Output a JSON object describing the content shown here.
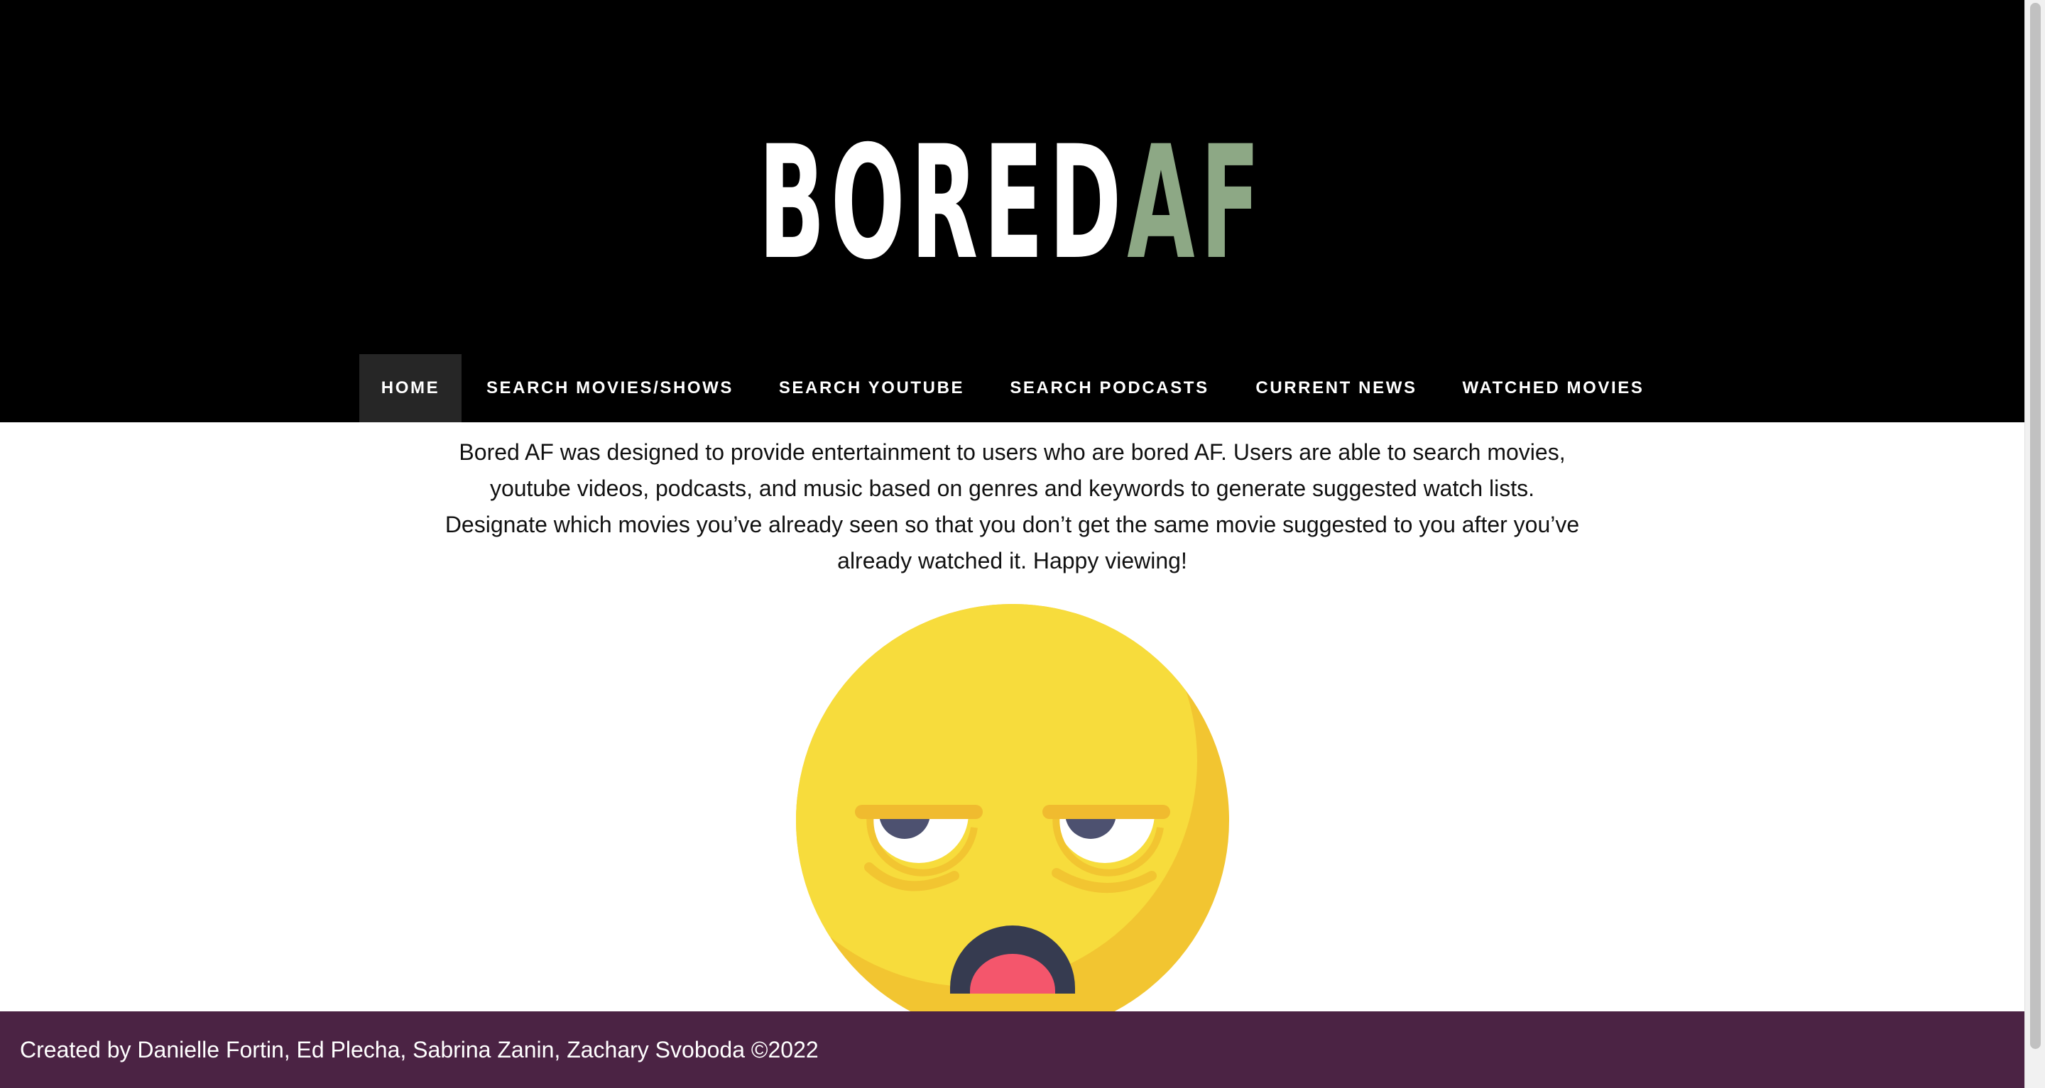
{
  "header": {
    "logo_part1": "BORED",
    "logo_part2": "AF"
  },
  "nav": {
    "items": [
      {
        "label": "HOME",
        "active": true
      },
      {
        "label": "SEARCH MOVIES/SHOWS",
        "active": false
      },
      {
        "label": "SEARCH YOUTUBE",
        "active": false
      },
      {
        "label": "SEARCH PODCASTS",
        "active": false
      },
      {
        "label": "CURRENT NEWS",
        "active": false
      },
      {
        "label": "WATCHED MOVIES",
        "active": false
      }
    ]
  },
  "main": {
    "intro_lines": [
      "Bored AF was designed to provide entertainment to users who are bored AF. Users are able to search movies,",
      "youtube videos, podcasts, and music based on genres and keywords to generate suggested watch lists.",
      "Designate which movies you’ve already seen so that you don’t get the same movie suggested to you after you’ve",
      "already watched it. Happy viewing!"
    ],
    "image_icon": "bored-face-emoji-icon"
  },
  "footer": {
    "credits": "Created by Danielle Fortin, Ed Plecha, Sabrina Zanin, Zachary Svoboda ©2022"
  },
  "colors": {
    "header_bg": "#000000",
    "logo_white": "#ffffff",
    "logo_green": "#8da885",
    "nav_active_bg": "#262626",
    "footer_bg": "#4b2344",
    "emoji_yellow": "#f7dc3c",
    "emoji_shade": "#f2c531",
    "emoji_mouth": "#363b50",
    "emoji_tongue": "#f4566c"
  }
}
